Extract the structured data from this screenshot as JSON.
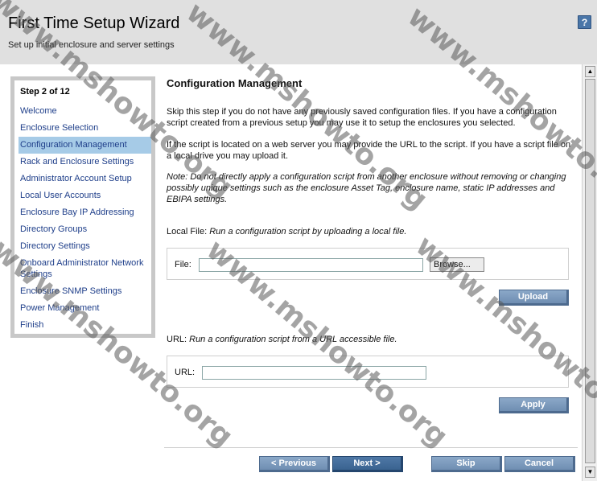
{
  "header": {
    "title": "First Time Setup Wizard",
    "subtitle": "Set up initial enclosure and server settings",
    "help_label": "?"
  },
  "sidebar": {
    "step_label": "Step 2 of 12",
    "items": [
      {
        "label": "Welcome"
      },
      {
        "label": "Enclosure Selection"
      },
      {
        "label": "Configuration Management"
      },
      {
        "label": "Rack and Enclosure Settings"
      },
      {
        "label": "Administrator Account Setup"
      },
      {
        "label": "Local User Accounts"
      },
      {
        "label": "Enclosure Bay IP Addressing"
      },
      {
        "label": "Directory Groups"
      },
      {
        "label": "Directory Settings"
      },
      {
        "label": "Onboard Administrator Network Settings"
      },
      {
        "label": "Enclosure SNMP Settings"
      },
      {
        "label": "Power Management"
      },
      {
        "label": "Finish"
      }
    ],
    "active_index": 2
  },
  "main": {
    "heading": "Configuration Management",
    "intro": "Skip this step if you do not have any previously saved configuration files. If you have a configuration script created from a previous setup you may use it to setup the enclosures you selected.",
    "web_server_text": "If the script is located on a web server you may provide the URL to the script. If you have a script file on a local drive you may upload it.",
    "note": "Note: Do not directly apply a configuration script from another enclosure without removing or changing possibly unique settings such as the enclosure Asset Tag, enclosure name, static IP addresses and EBIPA settings.",
    "local_file": {
      "label": "Local File:",
      "description": "Run a configuration script by uploading a local file.",
      "field_label": "File:",
      "value": "",
      "browse_label": "Browse...",
      "upload_label": "Upload"
    },
    "url_section": {
      "label": "URL:",
      "description": "Run a configuration script from a URL accessible file.",
      "field_label": "URL:",
      "value": "",
      "apply_label": "Apply"
    }
  },
  "footer": {
    "previous_label": "< Previous",
    "next_label": "Next >",
    "skip_label": "Skip",
    "cancel_label": "Cancel"
  },
  "watermark": {
    "text": "www.mshowto.org"
  },
  "colors": {
    "header_bg": "#e0e0e0",
    "nav_link": "#1f3f8a",
    "nav_active_bg": "#a6cbe7",
    "button_bg": "#7b99bd",
    "primary_button_bg": "#456d9b"
  }
}
